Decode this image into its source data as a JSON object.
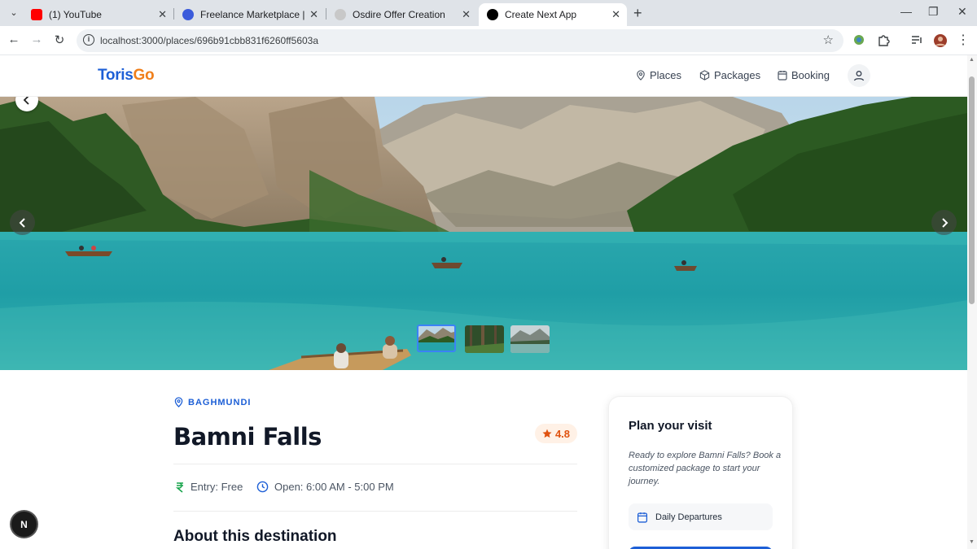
{
  "browser": {
    "tabs": [
      {
        "label": "(1) YouTube",
        "active": false,
        "favicon_color": "#ff0000"
      },
      {
        "label": "Freelance Marketplace | Find Top",
        "active": false,
        "favicon_color": "#3b5bdb"
      },
      {
        "label": "Osdire Offer Creation",
        "active": false,
        "favicon_color": "#c8c8c8"
      },
      {
        "label": "Create Next App",
        "active": true,
        "favicon_color": "#000000"
      }
    ],
    "url": "localhost:3000/places/696b91cbb831f6260ff5603a"
  },
  "header": {
    "logo_part1": "Toris",
    "logo_part2": "Go",
    "nav": [
      {
        "label": "Places",
        "icon": "map-pin-icon"
      },
      {
        "label": "Packages",
        "icon": "package-icon"
      },
      {
        "label": "Booking",
        "icon": "calendar-icon"
      }
    ]
  },
  "gallery": {
    "thumbnails": [
      "lake-thumbnail",
      "forest-thumbnail",
      "mountain-lake-thumbnail"
    ],
    "active_index": 0
  },
  "place": {
    "location": "BAGHMUNDI",
    "name": "Bamni Falls",
    "rating": "4.8",
    "entry": "Entry: Free",
    "hours": "Open: 6:00 AM - 5:00 PM",
    "about_heading": "About this destination"
  },
  "plan": {
    "title": "Plan your visit",
    "description": "Ready to explore Bamni Falls? Book a customized package to start your journey.",
    "departures": "Daily Departures"
  },
  "dev_badge": "N",
  "colors": {
    "brand_blue": "#1d5fd6",
    "brand_orange": "#f07f1b",
    "rating_orange": "#e0520f"
  }
}
